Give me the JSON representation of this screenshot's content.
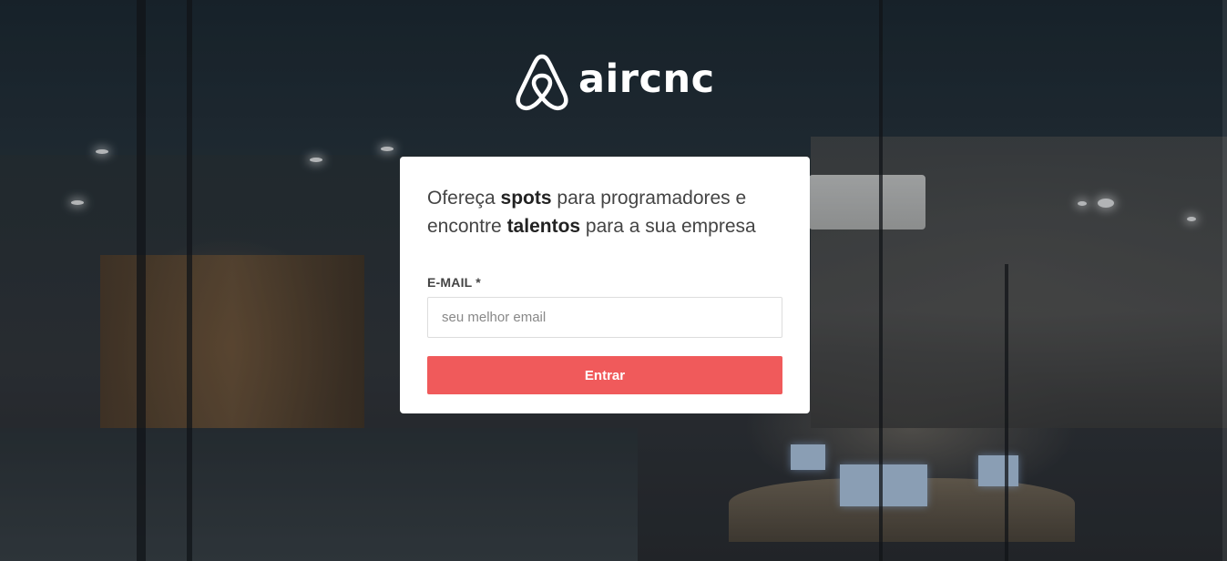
{
  "brand": {
    "name": "aircnc",
    "logo_icon": "airbnb-belo-icon",
    "text_color": "#ffffff"
  },
  "card": {
    "headline": {
      "part1": "Ofereça ",
      "bold1": "spots",
      "part2": " para programadores e encontre ",
      "bold2": "talentos",
      "part3": " para a sua empresa"
    },
    "email_label": "E-MAIL *",
    "email_value": "",
    "email_placeholder": "seu melhor email",
    "submit_label": "Entrar"
  },
  "colors": {
    "accent": "#f05a5b",
    "card_background": "#ffffff",
    "text": "#444444"
  }
}
